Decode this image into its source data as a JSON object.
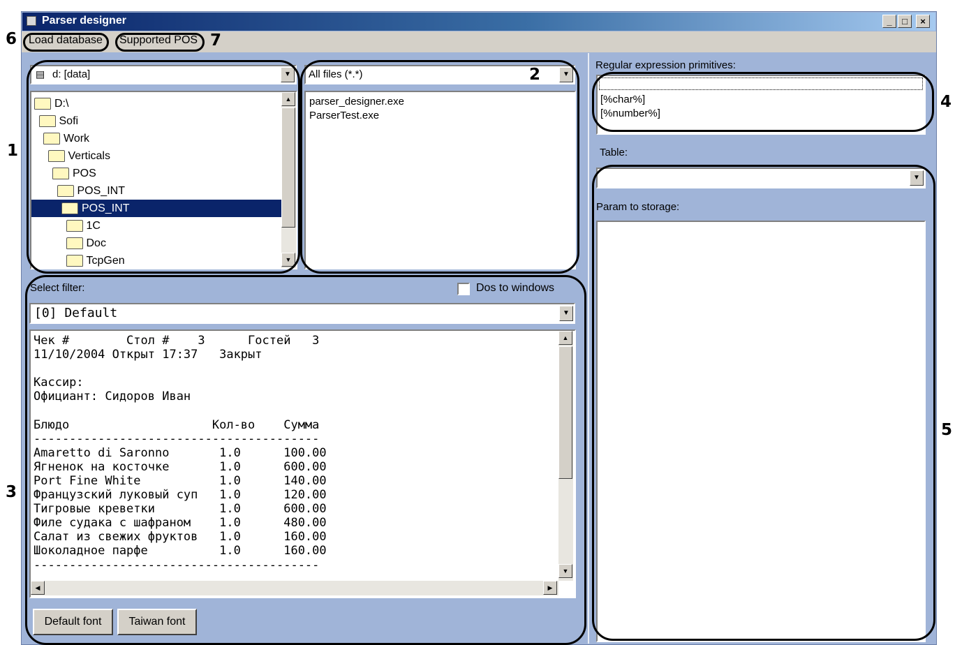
{
  "window": {
    "title": "Parser designer"
  },
  "title_buttons": {
    "minimize": "_",
    "maximize": "□",
    "close": "×"
  },
  "menu": {
    "load_database": "Load database",
    "supported_pos": "Supported POS"
  },
  "callouts": {
    "c1": "1",
    "c2": "2",
    "c3": "3",
    "c4": "4",
    "c5": "5",
    "c6": "6",
    "c7": "7"
  },
  "drive": {
    "value": "d: [data]"
  },
  "folders": [
    "D:\\",
    "Sofi",
    "Work",
    "Verticals",
    "POS",
    "POS_INT",
    "POS_INT",
    "1C",
    "Doc",
    "TcpGen"
  ],
  "selected_folder_index": 6,
  "file_filter": {
    "value": "All files (*.*)"
  },
  "files": [
    "parser_designer.exe",
    "ParserTest.exe"
  ],
  "select_filter": {
    "label": "Select filter:",
    "value": "[0] Default"
  },
  "dos_to_windows": {
    "label": "Dos to windows",
    "checked": false
  },
  "receipt_text": "Чек #        Стол #    3      Гостей   3\n11/10/2004 Открыт 17:37   Закрыт\n\nКассир:\nОфициант: Сидоров Иван\n\nБлюдо                    Кол-во    Сумма\n----------------------------------------\nAmaretto di Saronno       1.0      100.00\nЯгненок на косточке       1.0      600.00\nPort Fine White           1.0      140.00\nФранцузский луковый суп   1.0      120.00\nТигровые креветки         1.0      600.00\nФиле судака с шафраном    1.0      480.00\nСалат из свежих фруктов   1.0      160.00\nШоколадное парфе          1.0      160.00\n----------------------------------------",
  "buttons": {
    "default_font": "Default font",
    "taiwan_font": "Taiwan font"
  },
  "regex": {
    "label": "Regular expression primitives:",
    "items": [
      "[%char%]",
      "[%number%]"
    ]
  },
  "table": {
    "label": "Table:",
    "value": ""
  },
  "param_storage": {
    "label": "Param to storage:"
  }
}
